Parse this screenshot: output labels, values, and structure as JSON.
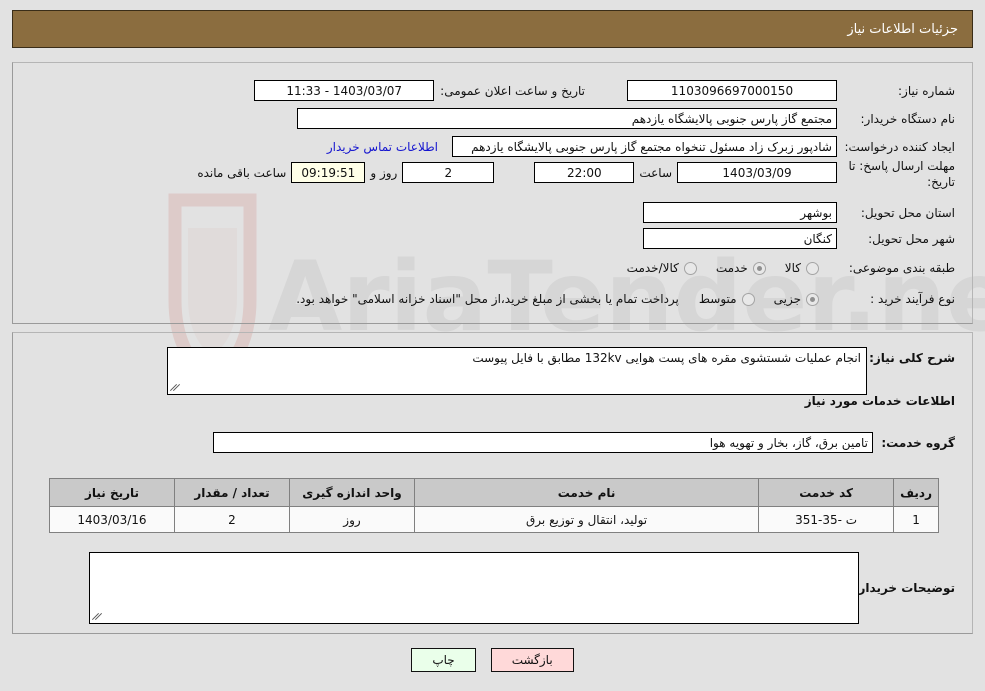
{
  "header": {
    "title": "جزئیات اطلاعات نیاز"
  },
  "fields": {
    "need_number_label": "شماره نیاز:",
    "need_number_value": "1103096697000150",
    "announce_label": "تاریخ و ساعت اعلان عمومی:",
    "announce_value": "1403/03/07 - 11:33",
    "buyer_org_label": "نام دستگاه خریدار:",
    "buyer_org_value": "مجتمع گاز پارس جنوبی  پالایشگاه یازدهم",
    "requester_label": "ایجاد کننده درخواست:",
    "requester_value": "شادپور زبرک زاد مسئول تنخواه مجتمع گاز پارس جنوبی  پالایشگاه یازدهم",
    "contact_link": "اطلاعات تماس خریدار",
    "deadline_label": "مهلت ارسال پاسخ: تا تاریخ:",
    "deadline_date": "1403/03/09",
    "deadline_hour_label": "ساعت",
    "deadline_hour": "22:00",
    "days_remaining": "2",
    "days_label": "روز و",
    "countdown": "09:19:51",
    "countdown_label": "ساعت باقی مانده",
    "province_label": "استان محل تحویل:",
    "province_value": "بوشهر",
    "city_label": "شهر محل تحویل:",
    "city_value": "کنگان",
    "category_label": "طبقه بندی موضوعی:",
    "process_label": "نوع فرآیند خرید :",
    "process_note": "پرداخت تمام یا بخشی از مبلغ خرید،از محل \"اسناد خزانه اسلامی\" خواهد بود."
  },
  "category_options": [
    {
      "label": "کالا",
      "selected": false
    },
    {
      "label": "خدمت",
      "selected": true
    },
    {
      "label": "کالا/خدمت",
      "selected": false
    }
  ],
  "process_options": [
    {
      "label": "جزیی",
      "selected": true
    },
    {
      "label": "متوسط",
      "selected": false
    }
  ],
  "summary": {
    "label": "شرح کلی نیاز:",
    "value": "انجام عملیات شستشوی مقره های پست هوایی 132kv مطابق با فایل پیوست"
  },
  "services_section": {
    "title": "اطلاعات خدمات مورد نیاز",
    "group_label": "گروه خدمت:",
    "group_value": "تامین برق، گاز، بخار و تهویه هوا"
  },
  "table": {
    "columns": [
      "ردیف",
      "کد خدمت",
      "نام خدمت",
      "واحد اندازه گیری",
      "تعداد / مقدار",
      "تاریخ نیاز"
    ],
    "rows": [
      {
        "row_no": "1",
        "service_code": "ت -35-351",
        "service_name": "تولید، انتقال و توزیع برق",
        "unit": "روز",
        "quantity": "2",
        "need_date": "1403/03/16"
      }
    ]
  },
  "buyer_notes": {
    "label": "توضیحات خریدار:",
    "value": ""
  },
  "buttons": {
    "print": "چاپ",
    "back": "بازگشت"
  },
  "colors": {
    "header_bg": "#8b6d3f",
    "header_text": "#ffffff",
    "link": "#1414cf",
    "timer_bg": "#ffffe8",
    "print_btn_bg": "#eaffea",
    "back_btn_bg": "#ffd9d9"
  }
}
